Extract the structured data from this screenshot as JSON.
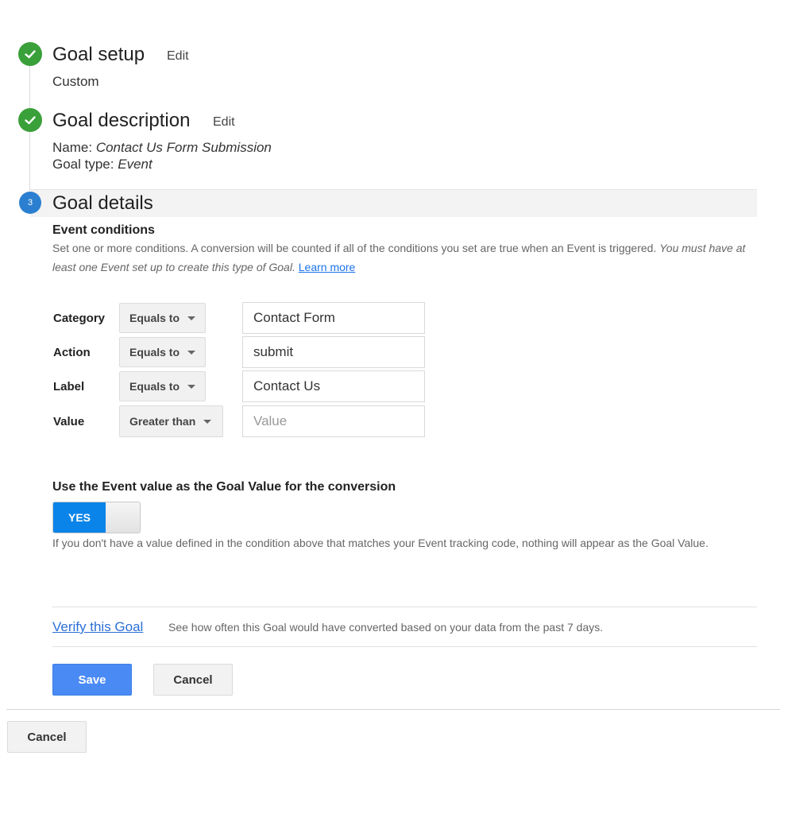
{
  "steps": [
    {
      "title": "Goal setup",
      "edit_label": "Edit",
      "status": "complete",
      "summary": "Custom"
    },
    {
      "title": "Goal description",
      "edit_label": "Edit",
      "status": "complete",
      "name_label": "Name:",
      "name_value": "Contact Us Form Submission",
      "type_label": "Goal type:",
      "type_value": "Event"
    },
    {
      "title": "Goal details",
      "number": "3",
      "status": "active"
    }
  ],
  "event_conditions": {
    "heading": "Event conditions",
    "description": "Set one or more conditions. A conversion will be counted if all of the conditions you set are true when an Event is triggered.",
    "description_italic": "You must have at least one Event set up to create this type of Goal.",
    "learn_more": "Learn more",
    "rows": [
      {
        "label": "Category",
        "operator": "Equals to",
        "value": "Contact Form",
        "placeholder": ""
      },
      {
        "label": "Action",
        "operator": "Equals to",
        "value": "submit",
        "placeholder": ""
      },
      {
        "label": "Label",
        "operator": "Equals to",
        "value": "Contact Us",
        "placeholder": ""
      },
      {
        "label": "Value",
        "operator": "Greater than",
        "value": "",
        "placeholder": "Value"
      }
    ]
  },
  "goal_value": {
    "heading": "Use the Event value as the Goal Value for the conversion",
    "toggle_label": "YES",
    "toggle_state": "on",
    "help": "If you don't have a value defined in the condition above that matches your Event tracking code, nothing will appear as the Goal Value."
  },
  "verify": {
    "link": "Verify this Goal",
    "description": "See how often this Goal would have converted based on your data from the past 7 days."
  },
  "actions": {
    "save": "Save",
    "cancel": "Cancel"
  },
  "footer": {
    "cancel": "Cancel"
  },
  "colors": {
    "complete": "#3aa03a",
    "active": "#2b7fd0",
    "primary": "#4a8af4",
    "link": "#1a73e8"
  }
}
